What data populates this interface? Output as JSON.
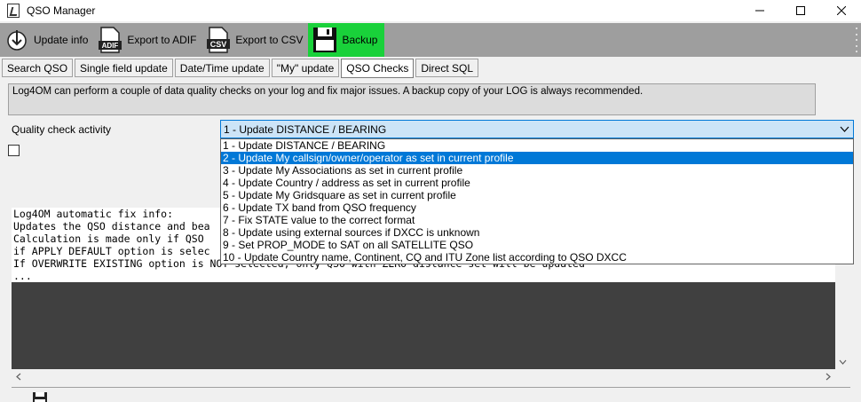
{
  "window": {
    "title": "QSO Manager"
  },
  "toolbar": {
    "update_info": "Update info",
    "export_adif": "Export to ADIF",
    "export_csv": "Export to CSV",
    "backup": "Backup",
    "adif_badge": "ADIF",
    "csv_badge": "CSV"
  },
  "tabs": [
    {
      "label": "Search QSO"
    },
    {
      "label": "Single field update"
    },
    {
      "label": "Date/Time update"
    },
    {
      "label": "\"My\" update"
    },
    {
      "label": "QSO Checks"
    },
    {
      "label": "Direct SQL"
    }
  ],
  "info": "Log4OM can perform a couple of data quality checks on your log and fix major issues. A backup copy of your LOG is always recommended.",
  "quality_check": {
    "label": "Quality check activity",
    "selected": "1 - Update DISTANCE / BEARING",
    "options": [
      "1 - Update DISTANCE / BEARING",
      "2 - Update My callsign/owner/operator as set in current profile",
      "3 - Update My Associations as set in current profile",
      "4 - Update Country / address as set in current profile",
      "5 - Update My Gridsquare as set in current profile",
      "6 - Update TX band from QSO frequency",
      "7 - Fix STATE value to the correct format",
      "8 - Update using external sources if DXCC is unknown",
      "9 - Set PROP_MODE to SAT on all SATELLITE QSO",
      "10 - Update Country name, Continent, CQ and ITU Zone list according to QSO DXCC"
    ]
  },
  "console": {
    "lines": [
      "Log4OM automatic fix info:",
      "Updates the QSO distance and bea",
      "Calculation is made only if QSO",
      "if APPLY DEFAULT option is selec",
      "If OVERWRITE EXISTING option is NOT selected, only QSO with ZERO distance set will be updated",
      "..."
    ]
  },
  "colors": {
    "toolbar_bg": "#9e9e9e",
    "backup_bg": "#19d13a",
    "selection": "#0078d7",
    "console_bg": "#404040"
  }
}
